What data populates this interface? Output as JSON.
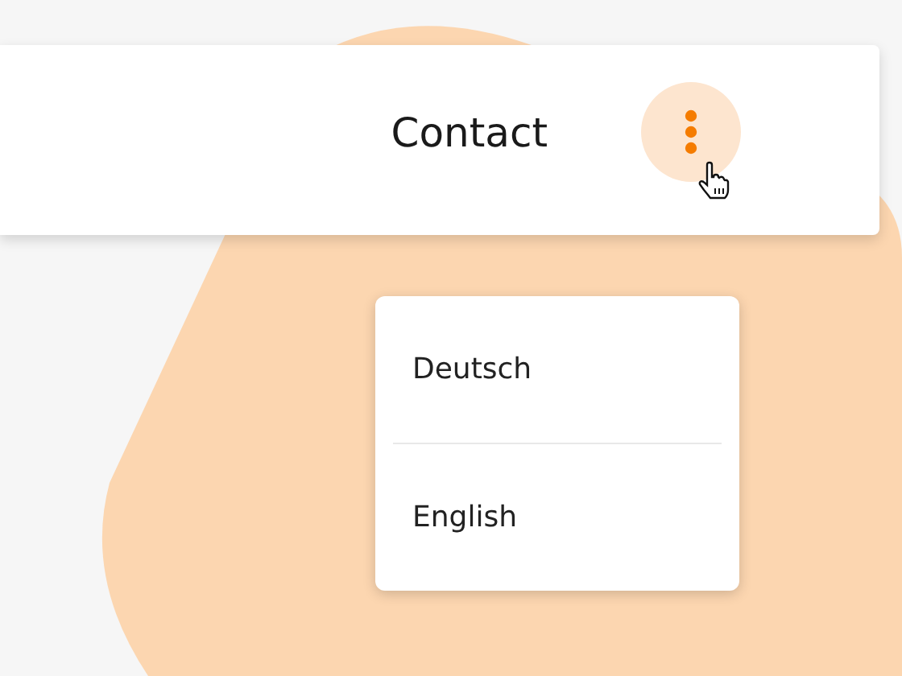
{
  "header": {
    "title": "Contact",
    "menu_button": {
      "expanded": true
    }
  },
  "menu": {
    "items": [
      {
        "label": "Deutsch"
      },
      {
        "label": "English"
      }
    ]
  }
}
